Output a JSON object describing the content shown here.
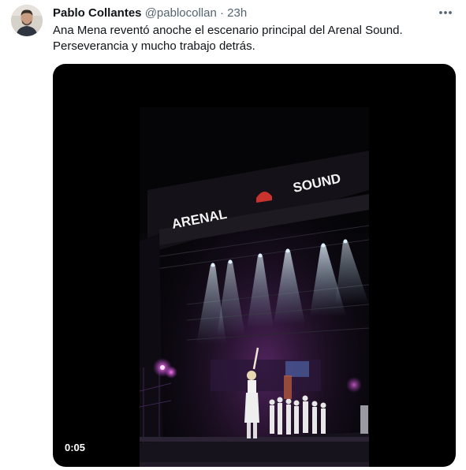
{
  "tweet": {
    "author_name": "Pablo Collantes",
    "handle": "@pablocollan",
    "separator": "·",
    "time_ago": "23h",
    "text_line_1": "Ana Mena reventó anoche el escenario principal del Arenal Sound.",
    "text_line_2": "Perseverancia y mucho trabajo detrás."
  },
  "media": {
    "type": "video",
    "duration": "0:05",
    "stage_sign_left": "ARENAL",
    "stage_sign_right": "SOUND"
  },
  "icons": {
    "more": "more-horizontal-icon"
  },
  "colors": {
    "text_primary": "#0f1419",
    "text_secondary": "#536471",
    "stage_light": "#e8f4ff",
    "stage_purple": "#c040e0"
  }
}
